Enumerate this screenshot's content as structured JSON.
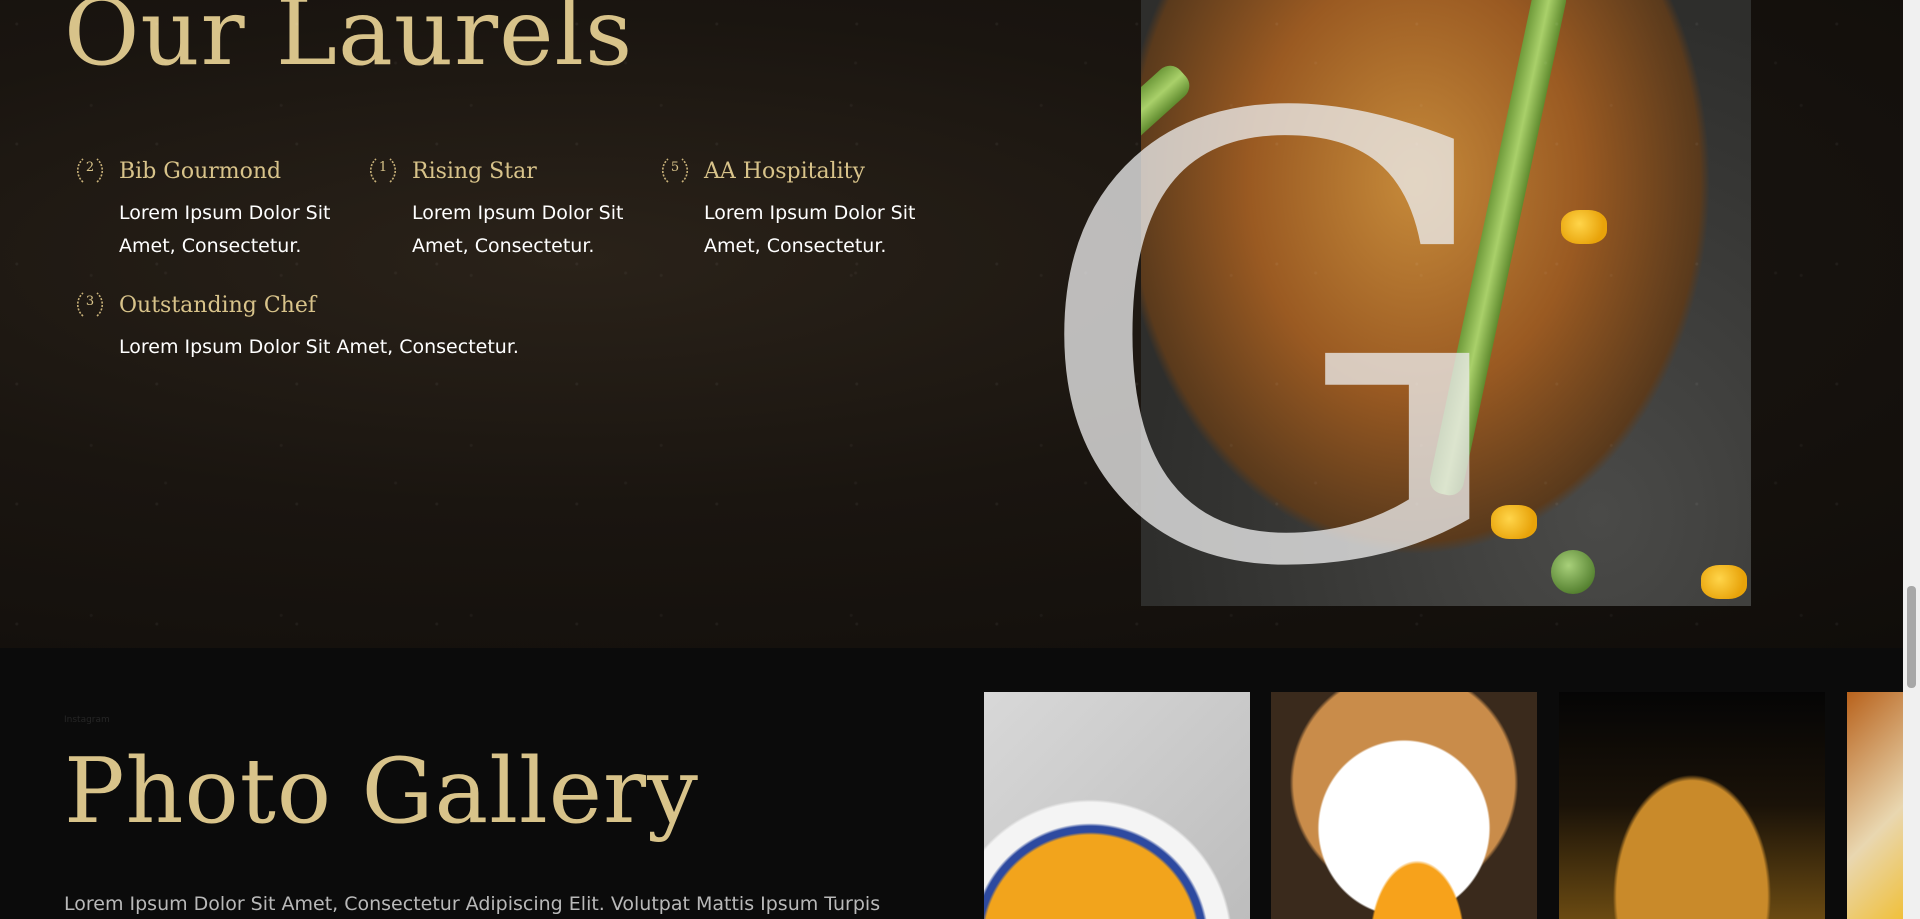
{
  "laurels": {
    "title": "Our Laurels",
    "awards": [
      {
        "number": "2",
        "name": "Bib Gourmond",
        "description": "Lorem Ipsum Dolor Sit Amet, Consectetur."
      },
      {
        "number": "1",
        "name": "Rising Star",
        "description": "Lorem Ipsum Dolor Sit Amet, Consectetur."
      },
      {
        "number": "5",
        "name": "AA Hospitality",
        "description": "Lorem Ipsum Dolor Sit Amet, Consectetur."
      },
      {
        "number": "3",
        "name": "Outstanding Chef",
        "description": "Lorem Ipsum Dolor Sit Amet, Consectetur."
      }
    ],
    "overlay_letter": "G"
  },
  "gallery": {
    "label": "Instagram",
    "title": "Photo Gallery",
    "description": "Lorem Ipsum Dolor Sit Amet, Consectetur Adipiscing Elit. Volutpat Mattis Ipsum Turpis"
  },
  "colors": {
    "accent_gold": "#d8c38a",
    "background_dark": "#0b0b0b"
  }
}
